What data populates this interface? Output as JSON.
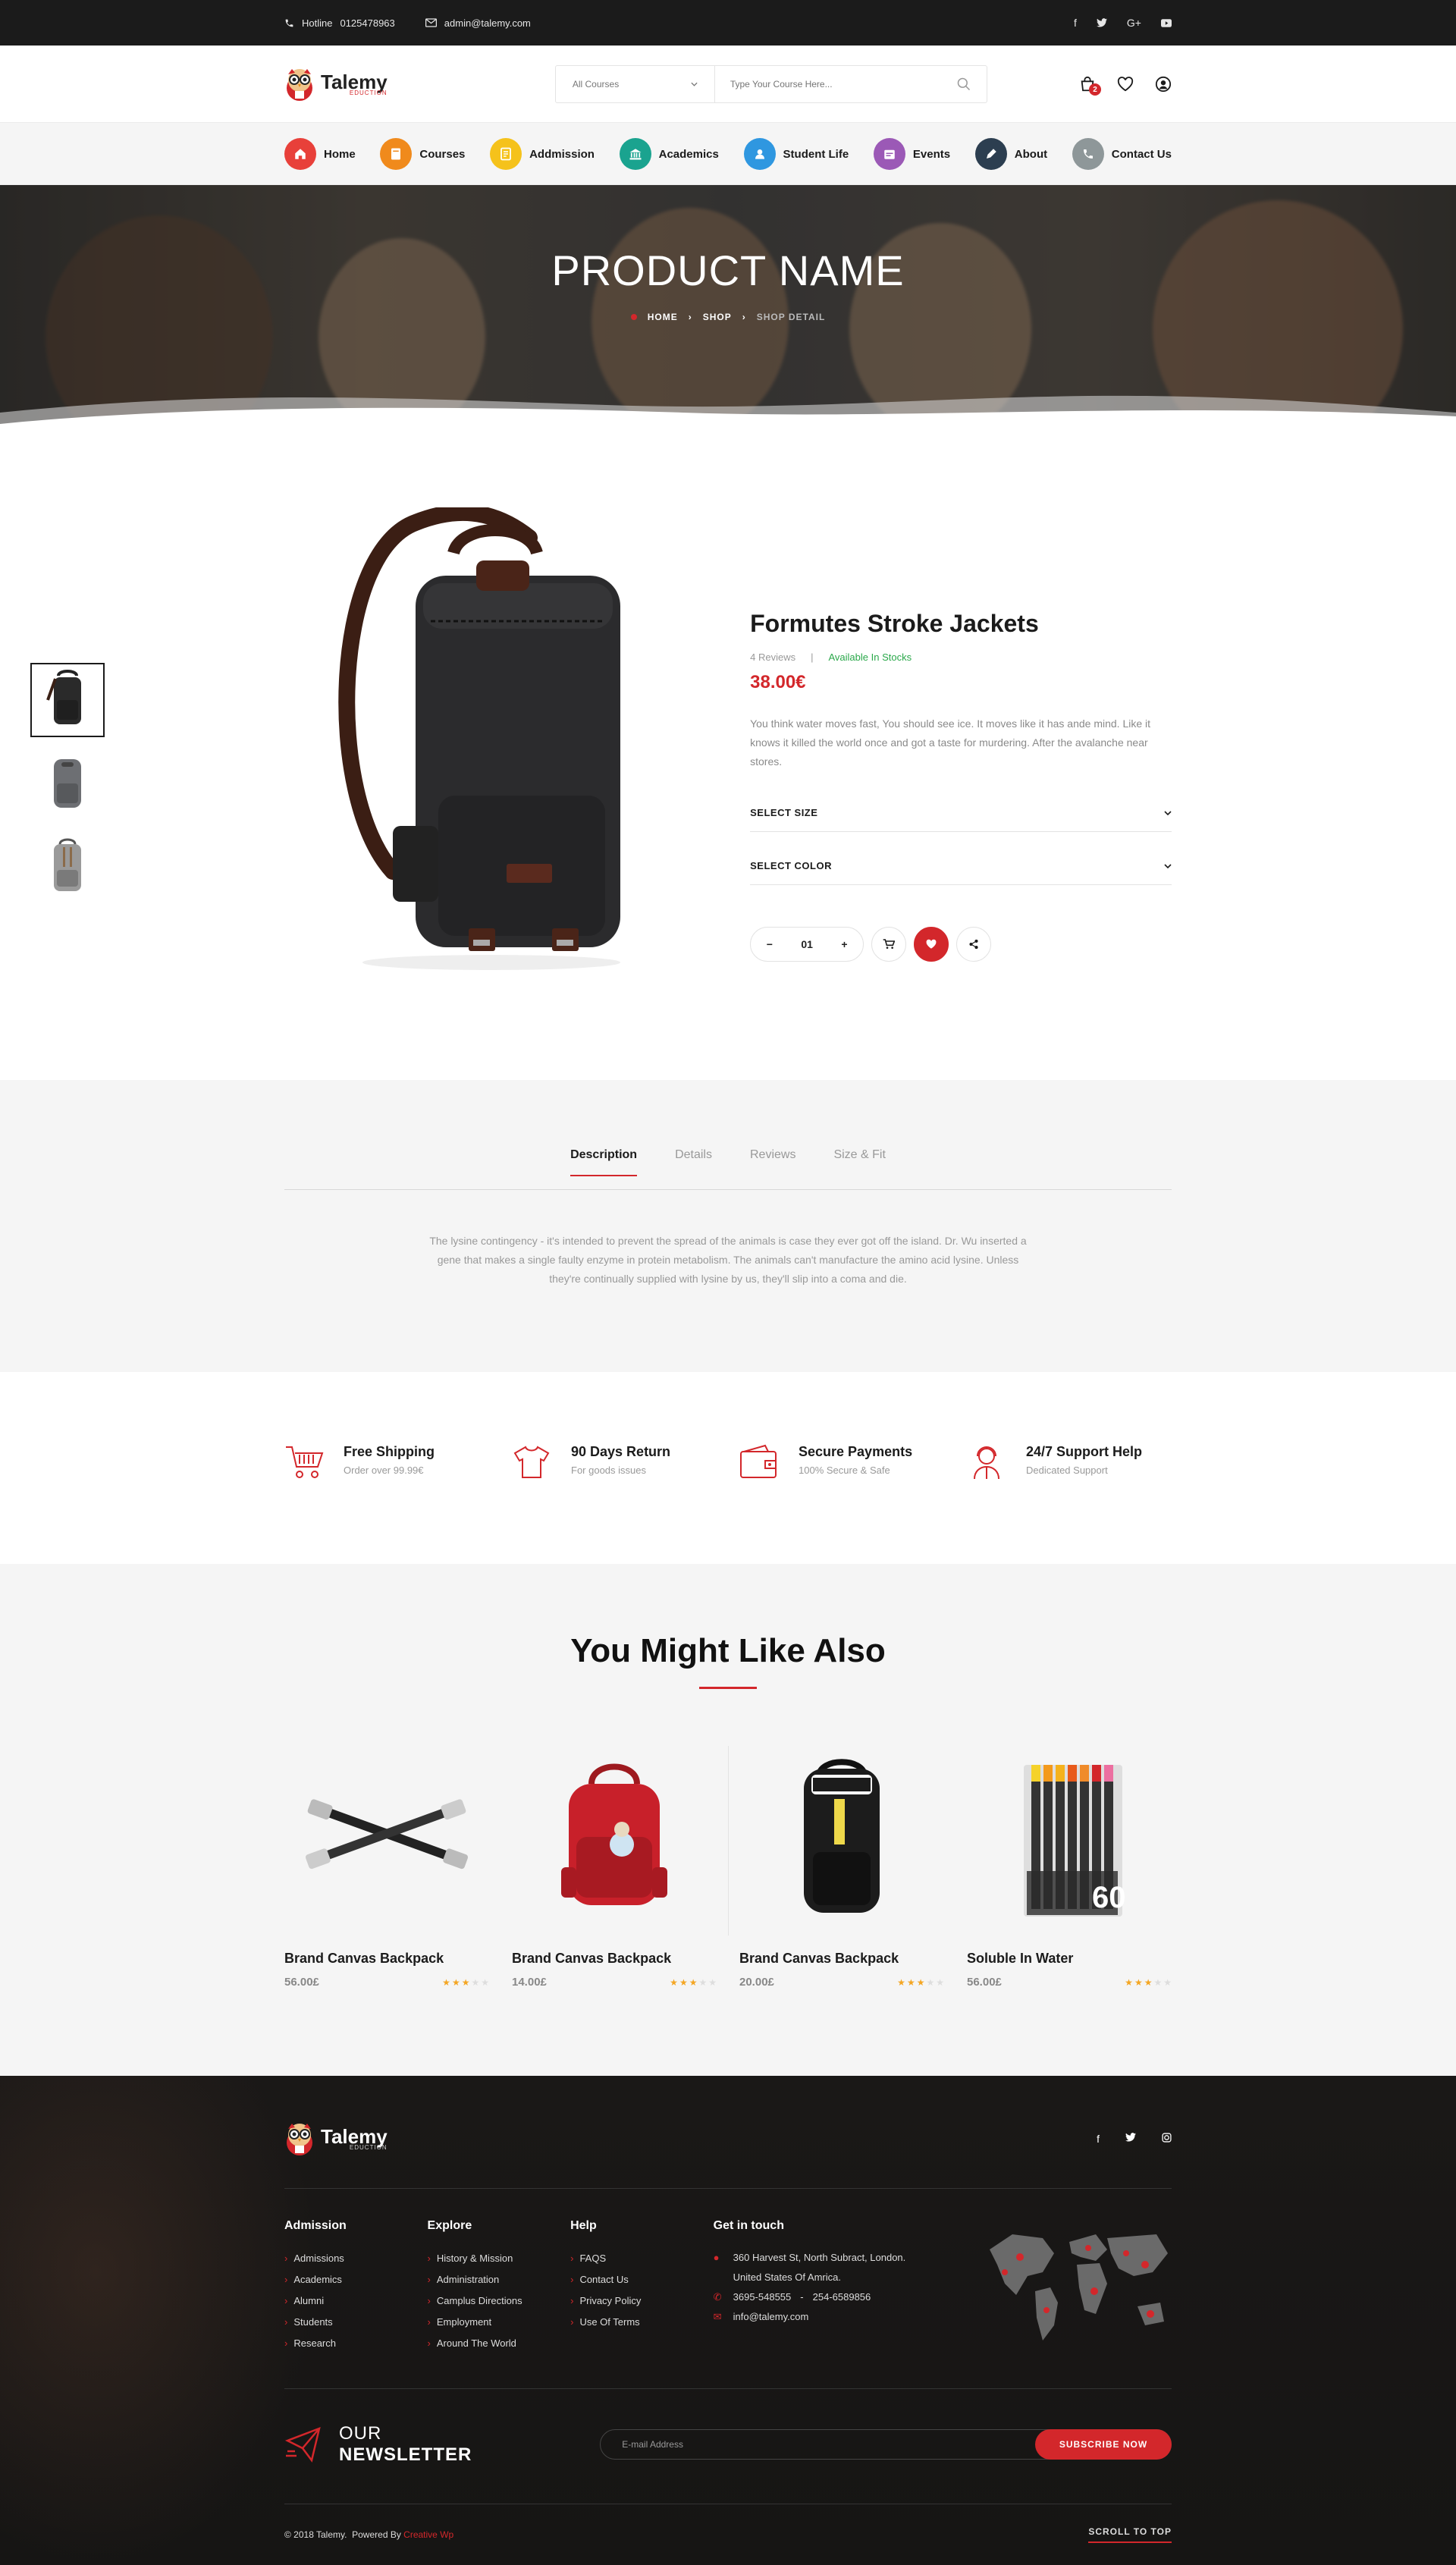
{
  "topbar": {
    "hotline_label": "Hotline",
    "hotline_number": "0125478963",
    "email": "admin@talemy.com",
    "social": [
      "f",
      "t",
      "G+",
      "yt"
    ]
  },
  "header": {
    "logo_name": "Talemy",
    "logo_sub": "EDUCTION",
    "category_label": "All Courses",
    "search_placeholder": "Type Your Course Here...",
    "cart_count": "2"
  },
  "nav": {
    "items": [
      {
        "label": "Home",
        "color": "#e8403a",
        "icon": "home-icon"
      },
      {
        "label": "Courses",
        "color": "#f08a1c",
        "icon": "book-icon"
      },
      {
        "label": "Addmission",
        "color": "#f5c21b",
        "icon": "document-icon"
      },
      {
        "label": "Academics",
        "color": "#1aa38f",
        "icon": "bank-icon"
      },
      {
        "label": "Student Life",
        "color": "#2f97e0",
        "icon": "user-icon"
      },
      {
        "label": "Events",
        "color": "#9b59b6",
        "icon": "calendar-icon"
      },
      {
        "label": "About",
        "color": "#2c3e50",
        "icon": "pen-icon"
      },
      {
        "label": "Contact Us",
        "color": "#8e9799",
        "icon": "phone-icon"
      }
    ]
  },
  "hero": {
    "title": "PRODUCT NAME",
    "crumbs": [
      "HOME",
      "SHOP",
      "SHOP DETAIL"
    ]
  },
  "product": {
    "name": "Formutes Stroke Jackets",
    "reviews": "4 Reviews",
    "stock": "Available In Stocks",
    "price": "38.00€",
    "description": "You think water moves fast, You should see ice. It moves like it has ande mind. Like it knows it killed the world once and got a taste for murdering. After the avalanche near stores.",
    "select_size": "SELECT SIZE",
    "select_color": "SELECT COLOR",
    "qty": "01",
    "qty_minus": "−",
    "qty_plus": "+"
  },
  "tabs": {
    "items": [
      "Description",
      "Details",
      "Reviews",
      "Size & Fit"
    ],
    "active": "Description",
    "text": "The lysine contingency - it's intended to prevent the spread of the animals is case they ever got off the island. Dr. Wu inserted a gene that makes a single faulty enzyme in protein metabolism. The animals can't manufacture the amino acid lysine. Unless they're continually supplied with lysine by us, they'll slip into a coma and die."
  },
  "features": [
    {
      "title": "Free Shipping",
      "sub": "Order over 99.99€",
      "icon": "cart-icon"
    },
    {
      "title": "90 Days Return",
      "sub": "For goods issues",
      "icon": "shirt-icon"
    },
    {
      "title": "Secure Payments",
      "sub": "100% Secure & Safe",
      "icon": "wallet-icon"
    },
    {
      "title": "24/7 Support Help",
      "sub": "Dedicated Support",
      "icon": "support-agent-icon"
    }
  ],
  "related": {
    "title": "You Might Like Also",
    "items": [
      {
        "name": "Brand Canvas Backpack",
        "price": "56.00£",
        "rating": 3
      },
      {
        "name": "Brand Canvas Backpack",
        "price": "14.00£",
        "rating": 3
      },
      {
        "name": "Brand Canvas Backpack",
        "price": "20.00£",
        "rating": 3
      },
      {
        "name": "Soluble In Water",
        "price": "56.00£",
        "rating": 3
      }
    ]
  },
  "footer": {
    "logo_name": "Talemy",
    "logo_sub": "EDUCTION",
    "social": [
      "f",
      "t",
      "ig"
    ],
    "cols": [
      {
        "title": "Admission",
        "links": [
          "Admissions",
          "Academics",
          "Alumni",
          "Students",
          "Research"
        ]
      },
      {
        "title": "Explore",
        "links": [
          "History & Mission",
          "Administration",
          "Camplus Directions",
          "Employment",
          "Around The World"
        ]
      },
      {
        "title": "Help",
        "links": [
          "FAQS",
          "Contact Us",
          "Privacy Policy",
          "Use Of Terms"
        ]
      }
    ],
    "contact_title": "Get in touch",
    "address1": "360 Harvest St, North Subract, London.",
    "address2": "United States Of Amrica.",
    "phone1": "3695-548555",
    "phone_sep": "-",
    "phone2": "254-6589856",
    "email": "info@talemy.com",
    "newsletter_prefix": "OUR",
    "newsletter_bold": "NEWSLETTER",
    "newsletter_placeholder": "E-mail Address",
    "subscribe": "SUBSCRIBE NOW",
    "copyright": "© 2018 Talemy.",
    "powered": "Powered By",
    "powered_by": "Creative Wp",
    "scroll_top": "SCROLL TO TOP"
  }
}
